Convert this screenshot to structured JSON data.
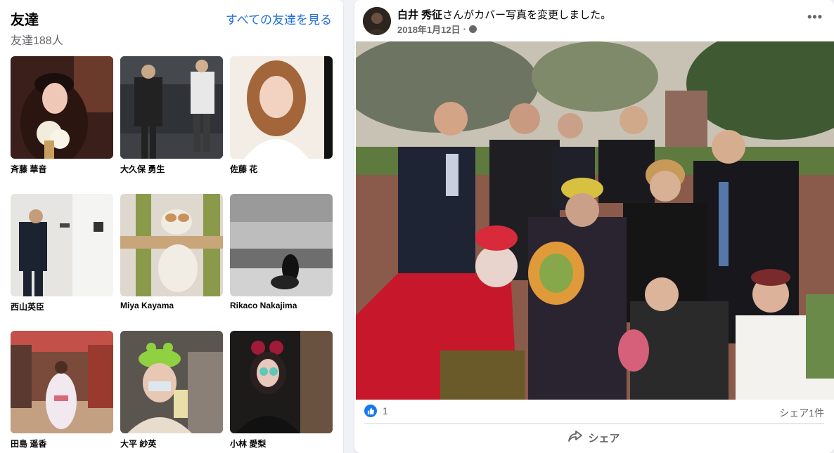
{
  "friends": {
    "title": "友達",
    "count_label": "友達188人",
    "see_all": "すべての友達を見る",
    "items": [
      {
        "name": "斉藤 華音"
      },
      {
        "name": "大久保 勇生"
      },
      {
        "name": "佐藤 花"
      },
      {
        "name": "西山英臣"
      },
      {
        "name": "Miya Kayama"
      },
      {
        "name": "Rikaco Nakajima"
      },
      {
        "name": "田島 遥香"
      },
      {
        "name": "大平 紗英"
      },
      {
        "name": "小林 愛梨"
      }
    ]
  },
  "post": {
    "author": "白井 秀征",
    "action": "さんがカバー写真を変更しました。",
    "date": "2018年1月12日",
    "date_sep": "·",
    "more": "•••",
    "reaction_count": "1",
    "shares": "シェア1件",
    "share_label": "シェア"
  },
  "colors": {
    "link": "#216fdb",
    "like_blue": "#1877f2",
    "secondary_text": "#65676b"
  }
}
